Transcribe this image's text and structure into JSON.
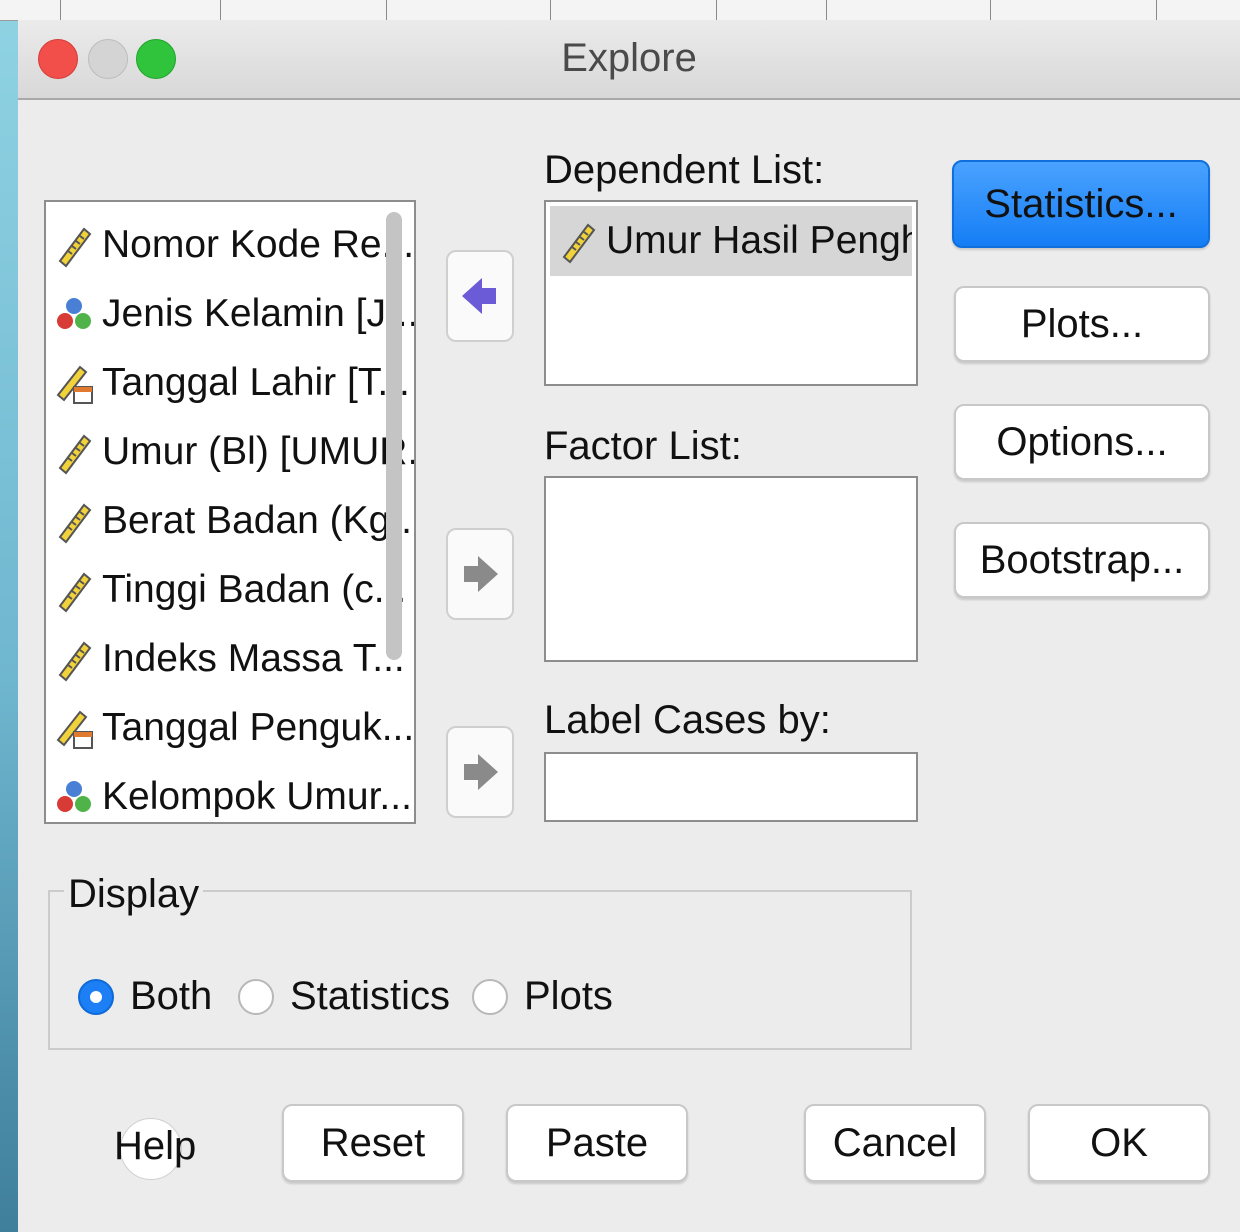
{
  "window": {
    "title": "Explore"
  },
  "variables": [
    {
      "label": "Nomor Kode Re...",
      "icon": "scale-ruler-icon"
    },
    {
      "label": "Jenis Kelamin [J...",
      "icon": "nominal-balls-icon"
    },
    {
      "label": "Tanggal Lahir [T...",
      "icon": "date-ruler-icon"
    },
    {
      "label": "Umur (Bl) [UMUR...",
      "icon": "scale-ruler-icon"
    },
    {
      "label": "Berat Badan (Kg...",
      "icon": "scale-ruler-icon"
    },
    {
      "label": "Tinggi Badan (c...",
      "icon": "scale-ruler-icon"
    },
    {
      "label": "Indeks Massa T...",
      "icon": "scale-ruler-icon"
    },
    {
      "label": "Tanggal Penguk...",
      "icon": "date-ruler-icon"
    },
    {
      "label": "Kelompok Umur...",
      "icon": "nominal-balls-icon"
    }
  ],
  "dependent_list": {
    "label": "Dependent List:",
    "items": [
      "Umur Hasil Penghit..."
    ]
  },
  "factor_list": {
    "label": "Factor List:"
  },
  "label_cases": {
    "label": "Label Cases by:"
  },
  "side_buttons": {
    "statistics": "Statistics...",
    "plots": "Plots...",
    "options": "Options...",
    "bootstrap": "Bootstrap..."
  },
  "display": {
    "label": "Display",
    "options": [
      "Both",
      "Statistics",
      "Plots"
    ],
    "selected": "Both"
  },
  "bottom_buttons": {
    "help": "Help",
    "reset": "Reset",
    "paste": "Paste",
    "cancel": "Cancel",
    "ok": "OK"
  },
  "colors": {
    "primary_button": "#1c7ff5",
    "radio_selected": "#1c7ff5",
    "arrow_active": "#6b5bd6",
    "arrow_inactive": "#8a8a8a"
  }
}
